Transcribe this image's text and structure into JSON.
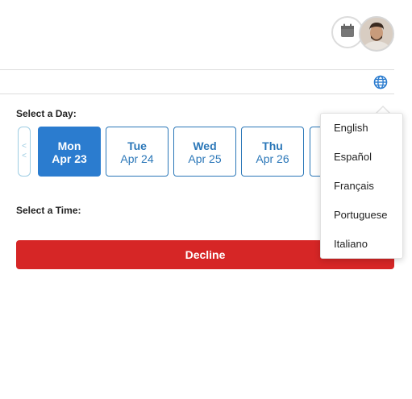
{
  "header": {
    "calendar_icon": "calendar-icon",
    "avatar_icon": "user-avatar"
  },
  "toolbar": {
    "globe_icon": "globe-icon"
  },
  "day_picker": {
    "label": "Select a Day:",
    "prev_arrow": "<\n<",
    "days": [
      {
        "name": "Mon",
        "date": "Apr 23",
        "selected": true
      },
      {
        "name": "Tue",
        "date": "Apr 24",
        "selected": false
      },
      {
        "name": "Wed",
        "date": "Apr 25",
        "selected": false
      },
      {
        "name": "Thu",
        "date": "Apr 26",
        "selected": false
      },
      {
        "name": "",
        "date": "",
        "selected": false
      }
    ]
  },
  "time_picker": {
    "label": "Select a Time:"
  },
  "actions": {
    "decline_label": "Decline"
  },
  "language_menu": {
    "options": [
      "English",
      "Español",
      "Français",
      "Portuguese",
      "Italiano"
    ]
  },
  "colors": {
    "accent": "#2b7ccf",
    "day_border": "#2b77b8",
    "decline": "#d62626"
  }
}
